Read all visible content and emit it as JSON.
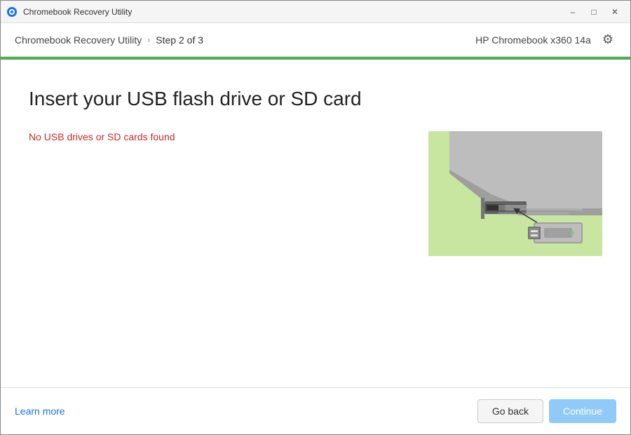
{
  "titlebar": {
    "icon": "chromebook-recovery-icon",
    "title": "Chromebook Recovery Utility",
    "minimize_label": "–",
    "maximize_label": "□",
    "close_label": "✕"
  },
  "header": {
    "app_name": "Chromebook Recovery Utility",
    "chevron": "›",
    "step_label": "Step 2 of 3",
    "device_name": "HP Chromebook x360 14a",
    "gear_icon": "⚙"
  },
  "main": {
    "page_title": "Insert your USB flash drive or SD card",
    "error_message": "No USB drives or SD cards found"
  },
  "footer": {
    "learn_more_label": "Learn more",
    "go_back_label": "Go back",
    "continue_label": "Continue"
  }
}
